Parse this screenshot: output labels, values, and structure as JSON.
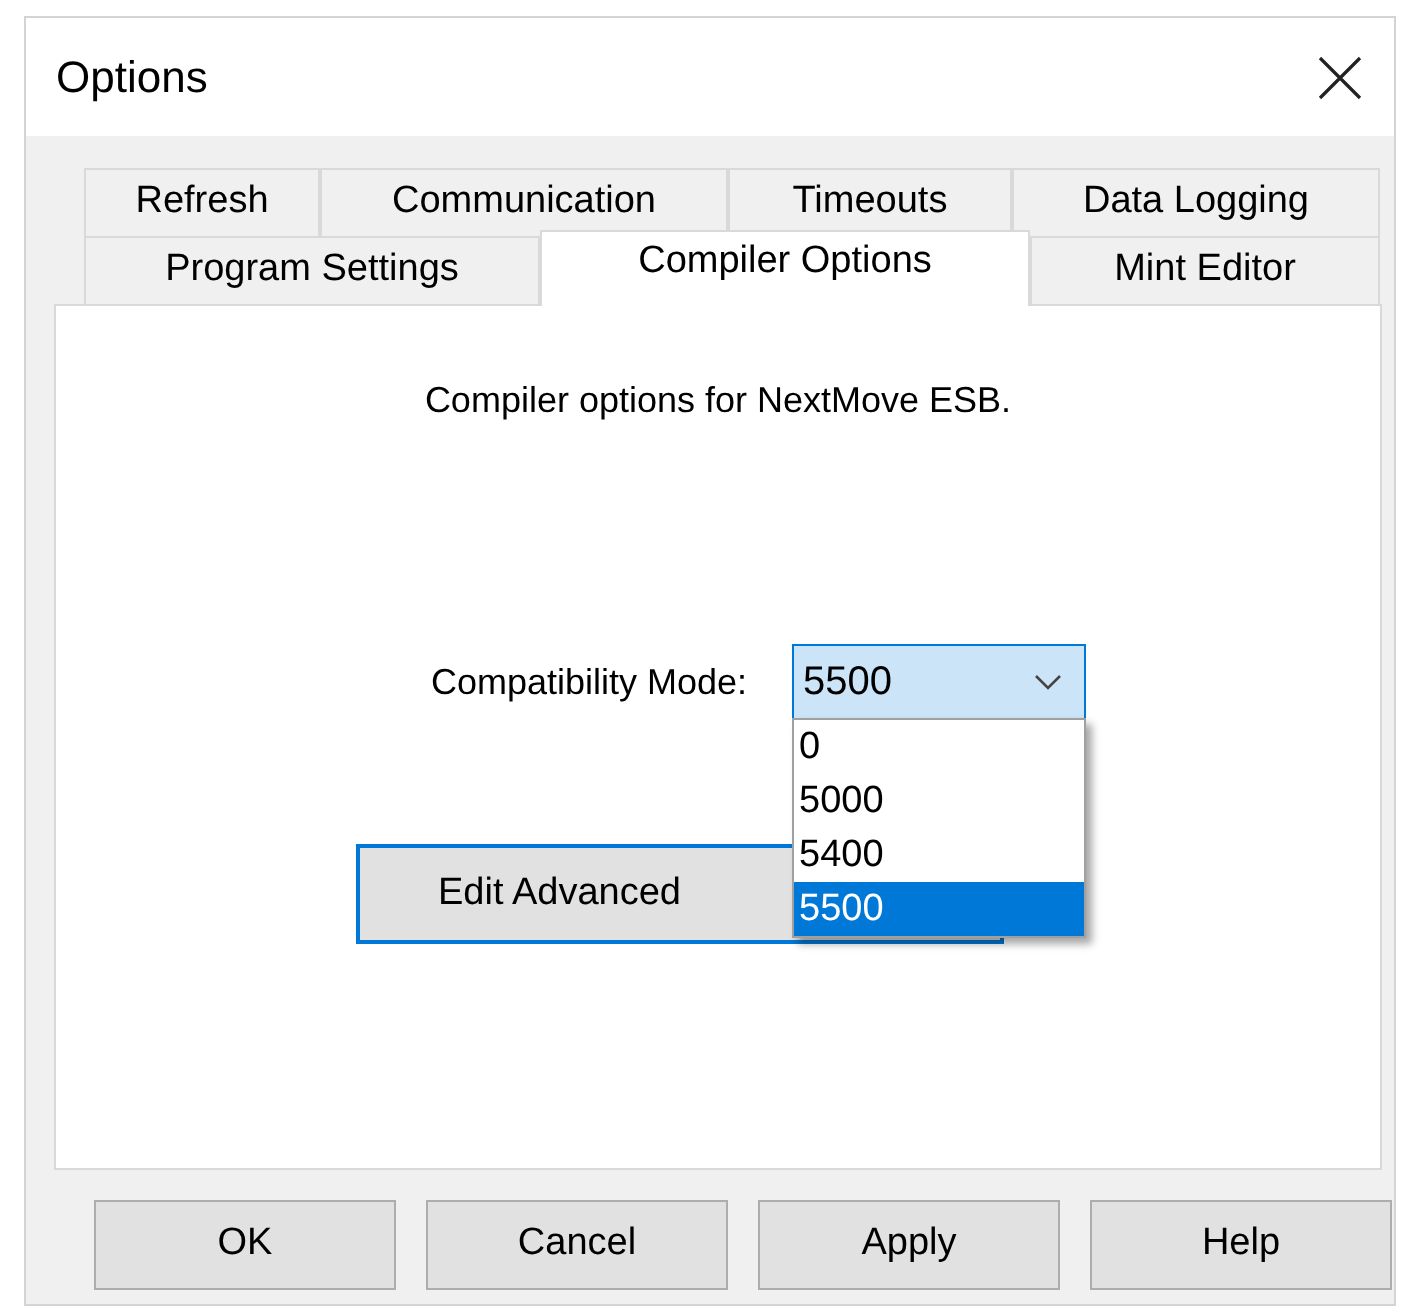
{
  "window": {
    "title": "Options"
  },
  "tab_rows": [
    [
      {
        "label": "Refresh",
        "selected": false
      },
      {
        "label": "Communication",
        "selected": false
      },
      {
        "label": "Timeouts",
        "selected": false
      },
      {
        "label": "Data Logging",
        "selected": false
      }
    ],
    [
      {
        "label": "Program Settings",
        "selected": false
      },
      {
        "label": "Compiler Options",
        "selected": true
      },
      {
        "label": "Mint Editor",
        "selected": false
      }
    ]
  ],
  "panel": {
    "description": "Compiler options for NextMove ESB.",
    "compatibility": {
      "label": "Compatibility Mode:",
      "value": "5500",
      "expanded": true,
      "options": [
        {
          "label": "0",
          "selected": false
        },
        {
          "label": "5000",
          "selected": false
        },
        {
          "label": "5400",
          "selected": false
        },
        {
          "label": "5500",
          "selected": true
        }
      ]
    },
    "advanced_button": "Edit Advanced"
  },
  "buttons": [
    "OK",
    "Cancel",
    "Apply",
    "Help"
  ]
}
